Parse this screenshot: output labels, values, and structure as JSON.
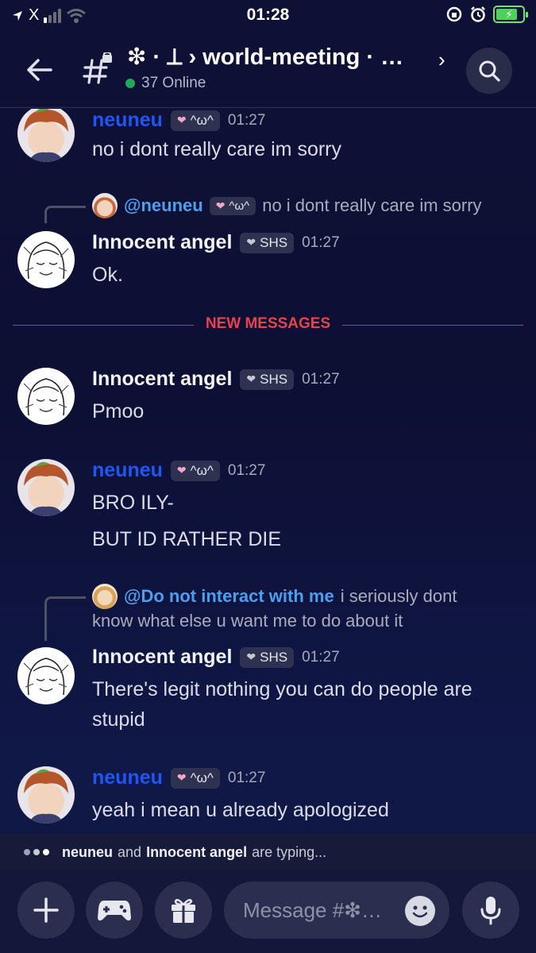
{
  "status_bar": {
    "carrier": "X",
    "time": "01:28"
  },
  "header": {
    "channel_title": "❇ · ⟂ › world-meeting · …",
    "chevron": "›",
    "online_text": "37 Online"
  },
  "messages": [
    {
      "author": "neuneu",
      "tag": "^ω^",
      "time": "01:27",
      "text": "no i dont really care im sorry"
    },
    {
      "reply": {
        "mention": "@neuneu",
        "tag": "^ω^",
        "text": "no i dont really care im sorry"
      },
      "author": "Innocent angel",
      "tag": "SHS",
      "time": "01:27",
      "text": "Ok."
    },
    {
      "author": "Innocent angel",
      "tag": "SHS",
      "time": "01:27",
      "text": "Pmoo"
    },
    {
      "author": "neuneu",
      "tag": "^ω^",
      "time": "01:27",
      "lines": [
        "BRO ILY-",
        "BUT ID RATHER DIE"
      ]
    },
    {
      "reply": {
        "mention": "@Do not interact with me",
        "text1": "i seriously dont",
        "text2": "know what else u want me to do about it"
      },
      "author": "Innocent angel",
      "tag": "SHS",
      "time": "01:27",
      "lines": [
        "There's legit nothing you can do people are",
        "stupid"
      ]
    },
    {
      "author": "neuneu",
      "tag": "^ω^",
      "time": "01:27",
      "text": "yeah i mean u already apologized"
    }
  ],
  "divider_label": "NEW MESSAGES",
  "typing": {
    "user1": "neuneu",
    "and": "and",
    "user2": "Innocent angel",
    "suffix": "are typing..."
  },
  "composer": {
    "placeholder": "Message #❇…"
  },
  "colors": {
    "mention": "#4e9ef0",
    "neuneu_name": "#1f56f5",
    "new_messages": "#e5444f",
    "online": "#23a55a"
  }
}
